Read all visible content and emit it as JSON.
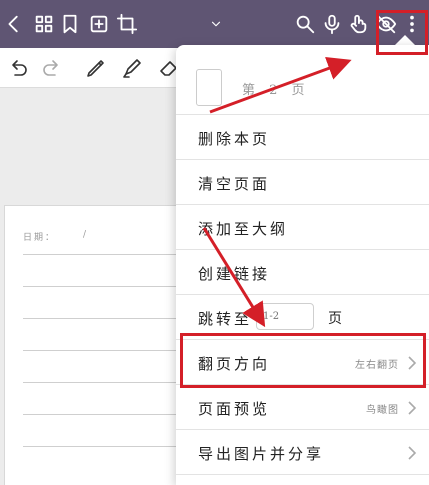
{
  "topbar": {
    "icons": [
      "back-icon",
      "grid-icon",
      "bookmark-icon",
      "add-page-icon",
      "crop-icon",
      "dropdown-icon",
      "search-icon",
      "mic-icon",
      "touch-icon",
      "eye-off-icon",
      "more-icon"
    ]
  },
  "toolbar": {
    "tools": [
      "undo-icon",
      "redo-icon",
      "pen-icon",
      "highlighter-icon",
      "eraser-icon"
    ]
  },
  "paper": {
    "date_label": "日期：",
    "date_sep": "/"
  },
  "menu": {
    "page_label": "第 2 页",
    "items": [
      {
        "label": "删除本页"
      },
      {
        "label": "清空页面"
      },
      {
        "label": "添加至大纲"
      },
      {
        "label": "创建链接"
      }
    ],
    "jump": {
      "label": "跳转至",
      "placeholder": "1-2",
      "suffix": "页"
    },
    "flip": {
      "label": "翻页方向",
      "value": "左右翻页"
    },
    "preview": {
      "label": "页面预览",
      "value": "鸟瞰图"
    },
    "export": {
      "label": "导出图片并分享"
    }
  },
  "annotation_colors": {
    "highlight": "#d41f28",
    "topbar_bg": "#5f5573"
  }
}
